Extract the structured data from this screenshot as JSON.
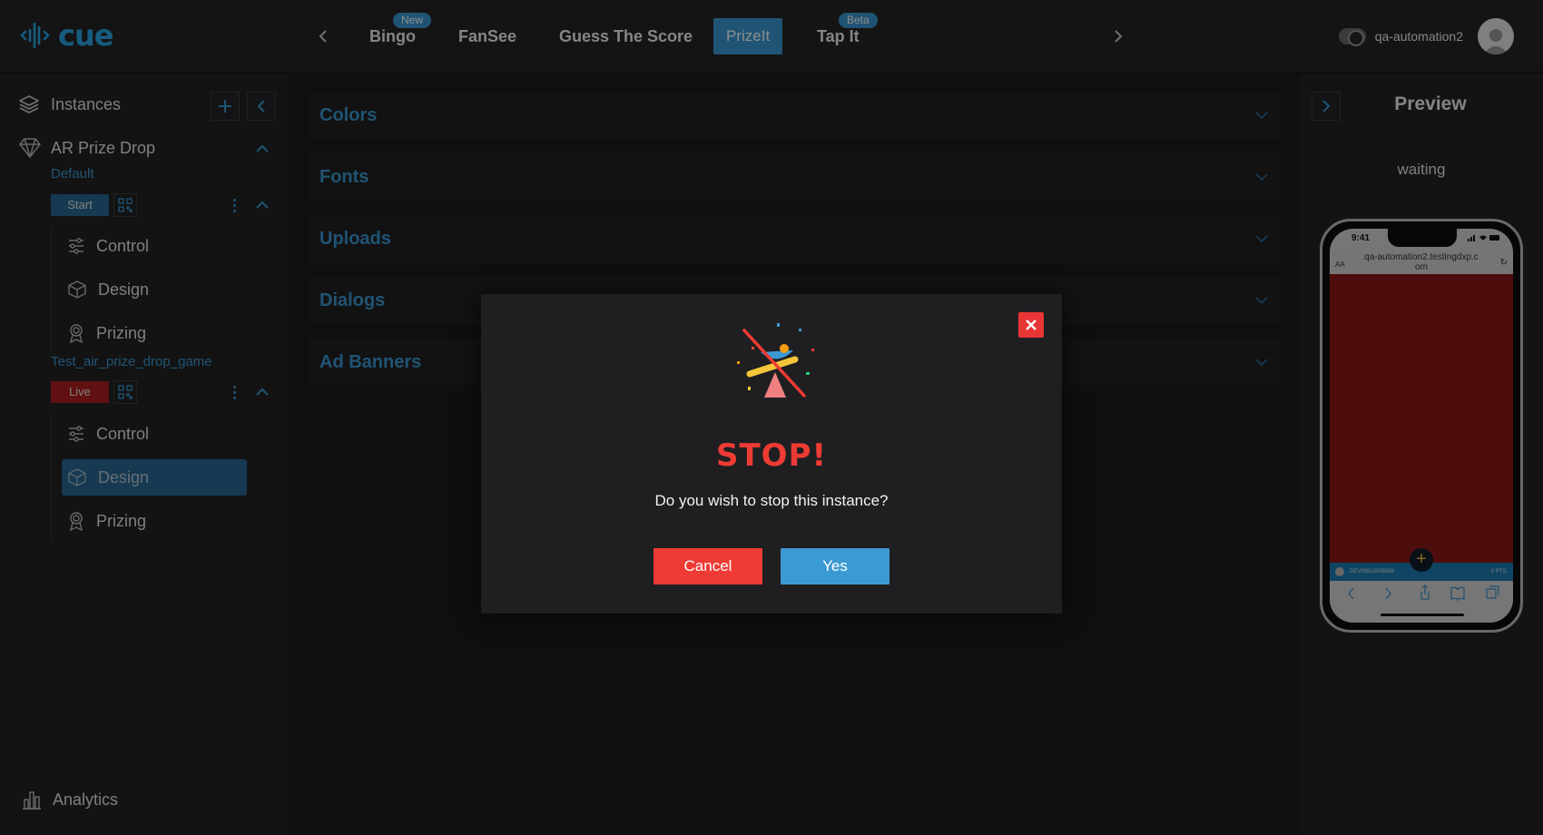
{
  "app": {
    "logo_text": "cue"
  },
  "nav": {
    "tabs": [
      {
        "label": "Bingo",
        "badge": "New"
      },
      {
        "label": "FanSee"
      },
      {
        "label": "Guess The Score"
      },
      {
        "label": "PrizeIt",
        "active": true
      },
      {
        "label": "Tap It",
        "badge": "Beta"
      }
    ]
  },
  "user": {
    "name": "qa-automation2"
  },
  "sidebar": {
    "heading": "Instances",
    "game": "AR Prize Drop",
    "instances": [
      {
        "name": "Default",
        "status": "Start",
        "status_color": "#2a6a96",
        "menu": [
          {
            "label": "Control",
            "icon": "sliders-icon"
          },
          {
            "label": "Design",
            "icon": "cube-icon"
          },
          {
            "label": "Prizing",
            "icon": "award-icon"
          }
        ]
      },
      {
        "name": "Test_air_prize_drop_game",
        "status": "Live",
        "status_color": "#b12020",
        "menu": [
          {
            "label": "Control",
            "icon": "sliders-icon"
          },
          {
            "label": "Design",
            "icon": "cube-icon",
            "active": true
          },
          {
            "label": "Prizing",
            "icon": "award-icon"
          }
        ]
      }
    ],
    "footer": {
      "label": "Analytics"
    }
  },
  "main": {
    "sections": [
      "Colors",
      "Fonts",
      "Uploads",
      "Dialogs",
      "Ad Banners"
    ]
  },
  "preview": {
    "title": "Preview",
    "status": "waiting",
    "phone": {
      "time": "9:41",
      "aa": "AA",
      "url": "qa-automation2.testingdxp.com",
      "device_id": "DEV09513038356",
      "points": "0 PTS."
    }
  },
  "modal": {
    "title": "STOP!",
    "message": "Do you wish to stop this instance?",
    "cancel_label": "Cancel",
    "yes_label": "Yes"
  },
  "colors": {
    "accent": "#3b9ad3",
    "danger": "#ee3b34",
    "background": "#1c1c1e"
  }
}
